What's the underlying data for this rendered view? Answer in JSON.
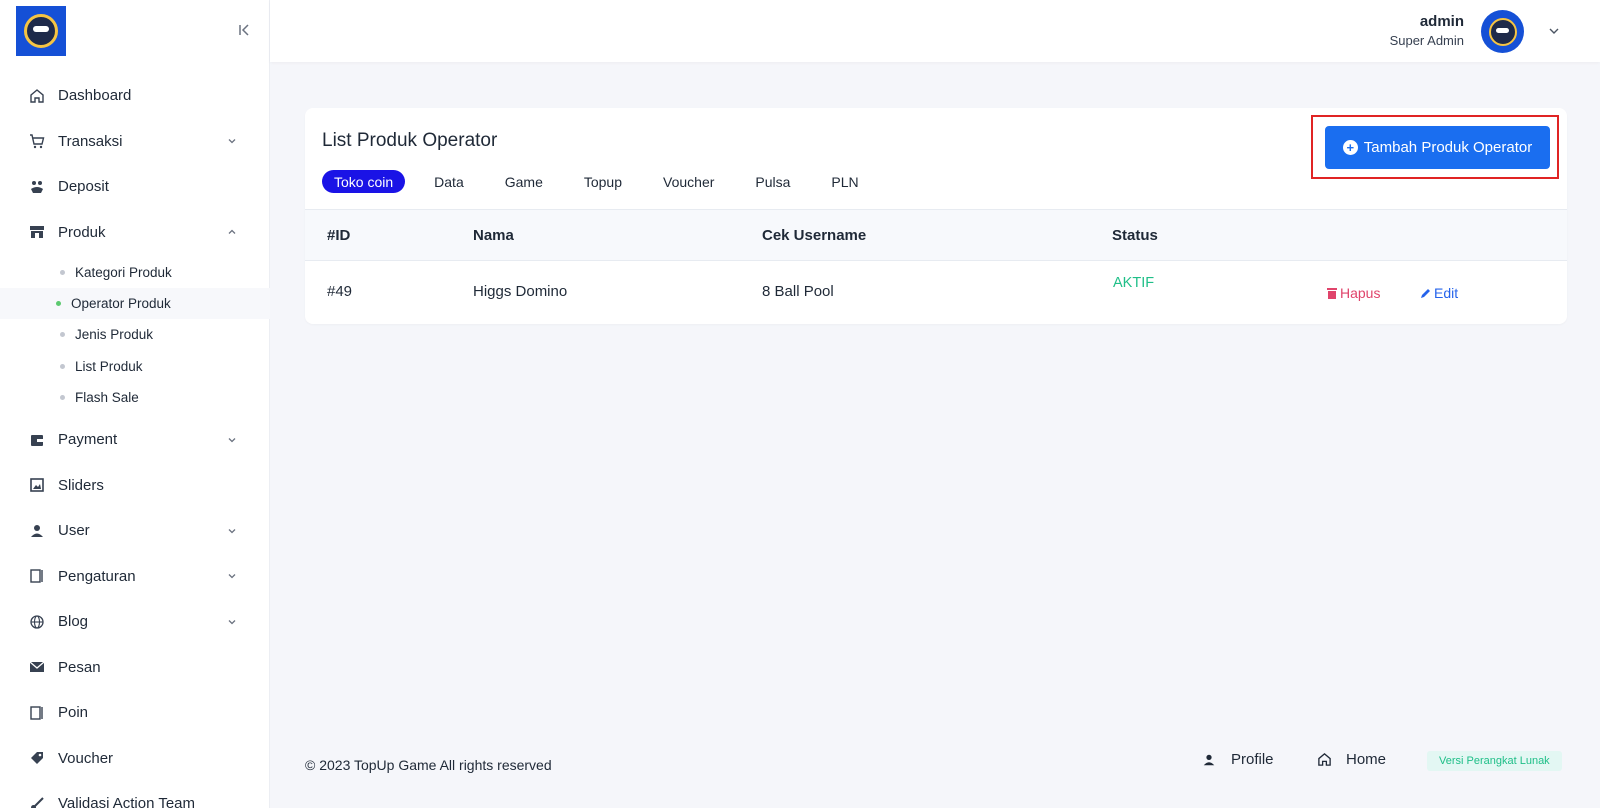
{
  "sidebar": {
    "items": [
      {
        "label": "Dashboard",
        "icon": "home-icon",
        "has_children": false
      },
      {
        "label": "Transaksi",
        "icon": "cart-icon",
        "has_children": true
      },
      {
        "label": "Deposit",
        "icon": "deposit-icon",
        "has_children": false
      },
      {
        "label": "Produk",
        "icon": "store-icon",
        "has_children": true,
        "expanded": true
      },
      {
        "label": "Payment",
        "icon": "wallet-icon",
        "has_children": true
      },
      {
        "label": "Sliders",
        "icon": "image-icon",
        "has_children": false
      },
      {
        "label": "User",
        "icon": "user-icon",
        "has_children": true
      },
      {
        "label": "Pengaturan",
        "icon": "settings-panel-icon",
        "has_children": true
      },
      {
        "label": "Blog",
        "icon": "globe-icon",
        "has_children": true
      },
      {
        "label": "Pesan",
        "icon": "mail-icon",
        "has_children": false
      },
      {
        "label": "Poin",
        "icon": "panel-icon",
        "has_children": false
      },
      {
        "label": "Voucher",
        "icon": "tag-icon",
        "has_children": false
      },
      {
        "label": "Validasi Action Team",
        "icon": "brush-icon",
        "has_children": false
      }
    ],
    "produk_sub": [
      {
        "label": "Kategori Produk"
      },
      {
        "label": "Operator Produk",
        "active": true
      },
      {
        "label": "Jenis Produk"
      },
      {
        "label": "List Produk"
      },
      {
        "label": "Flash Sale"
      }
    ]
  },
  "header": {
    "user_name": "admin",
    "user_role": "Super Admin"
  },
  "card": {
    "title": "List Produk Operator",
    "add_button": "Tambah Produk Operator",
    "tabs": [
      "Toko coin",
      "Data",
      "Game",
      "Topup",
      "Voucher",
      "Pulsa",
      "PLN"
    ],
    "active_tab": "Toko coin",
    "columns": [
      "#ID",
      "Nama",
      "Cek Username",
      "Status"
    ],
    "rows": [
      {
        "id": "#49",
        "nama": "Higgs Domino",
        "cek_username": "8 Ball Pool",
        "status": "AKTIF",
        "delete_label": "Hapus",
        "edit_label": "Edit"
      }
    ]
  },
  "footer": {
    "copyright": "© 2023 TopUp Game All rights reserved",
    "profile_link": "Profile",
    "home_link": "Home",
    "version_badge": "Versi Perangkat Lunak"
  },
  "colors": {
    "primary": "#1a6ef0",
    "active_tab": "#1a13e6",
    "status_active": "#1fbf88",
    "danger": "#e0446b",
    "highlight_outline": "#e02424"
  }
}
